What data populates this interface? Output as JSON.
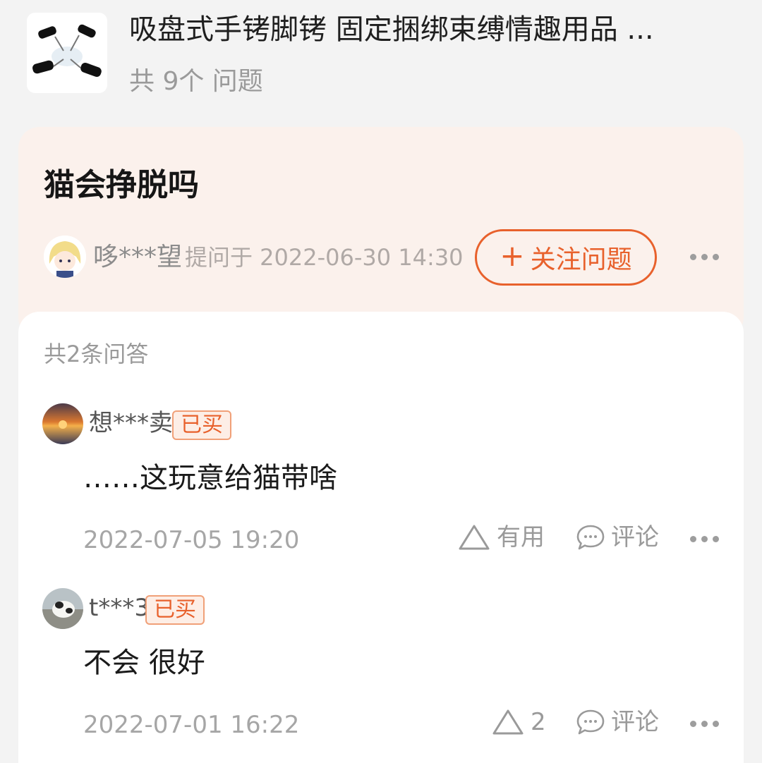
{
  "product": {
    "title": "吸盘式手铐脚铐 固定捆绑束缚情趣用品 ...",
    "question_count": "共 9个 问题",
    "thumbnail_icon": "product-cuffs-image"
  },
  "question": {
    "title": "猫会挣脱吗",
    "asker_name": "哆***望",
    "asked_at": "提问于 2022-06-30 14:30",
    "follow_label": "关注问题",
    "follow_icon": "+",
    "accent_color": "#e8612c"
  },
  "answers": {
    "count_label": "共2条问答",
    "items": [
      {
        "user": "想***卖",
        "badge": "已买",
        "text": "……这玩意给猫带啥",
        "time": "2022-07-05 19:20",
        "useful_label": "有用",
        "comment_label": "评论"
      },
      {
        "user": "t***3",
        "badge": "已买",
        "text": "不会 很好",
        "time": "2022-07-01 16:22",
        "useful_label": "2",
        "comment_label": "评论"
      }
    ]
  }
}
